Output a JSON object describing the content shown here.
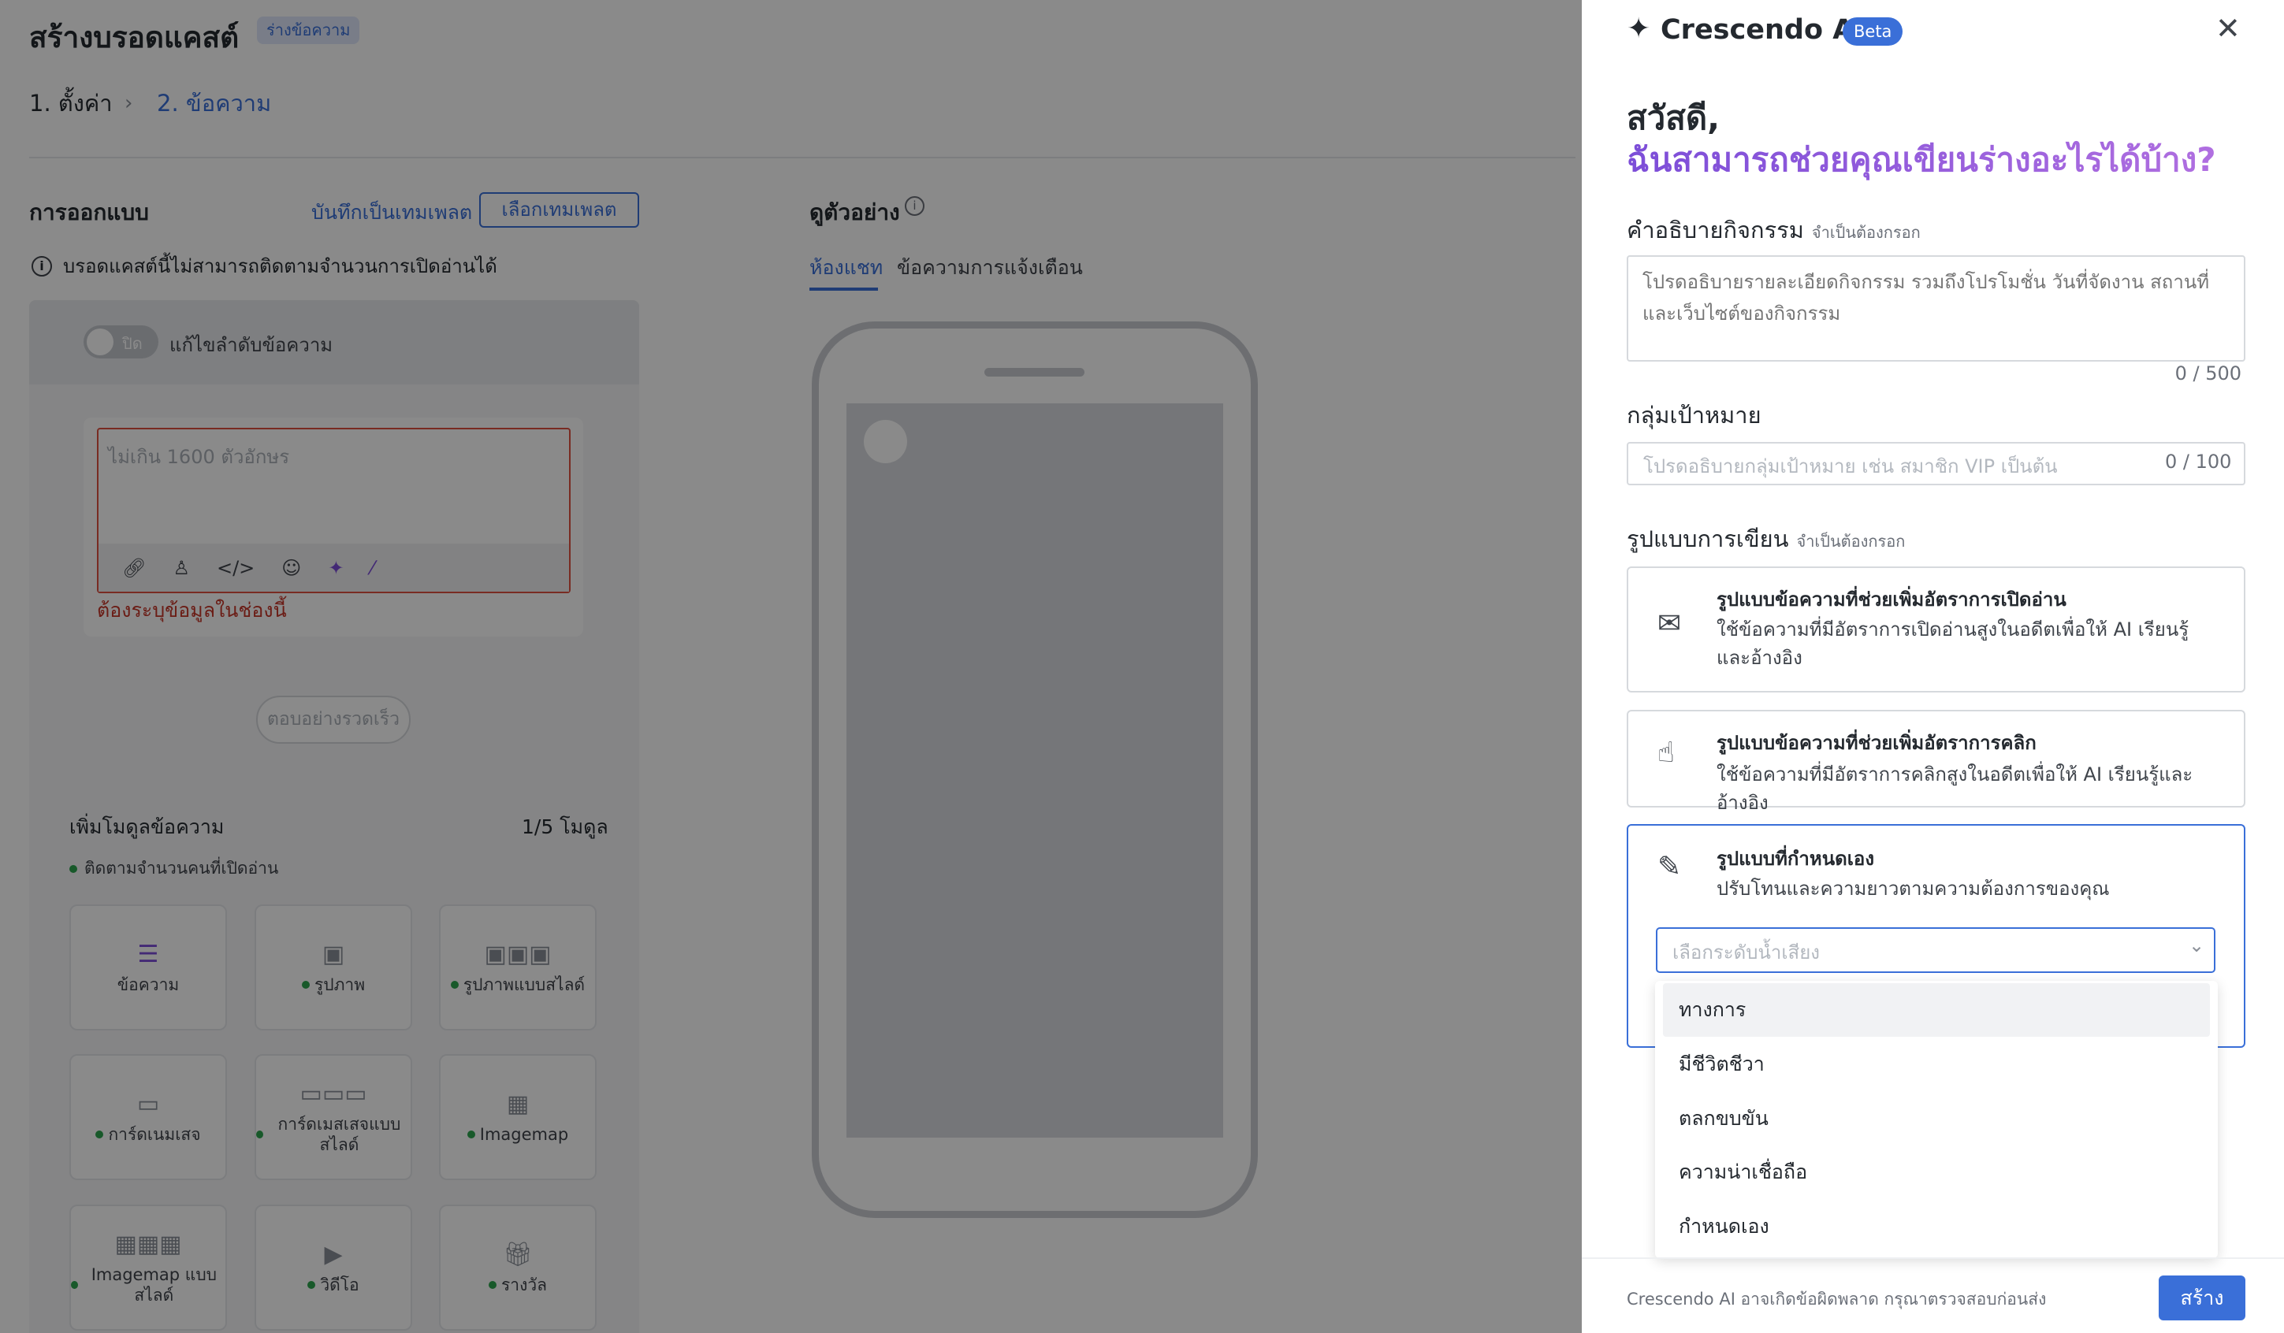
{
  "page": {
    "title": "สร้างบรอดแคสต์",
    "badge": "ร่างข้อความ",
    "steps": [
      "1. ตั้งค่า",
      "2. ข้อความ"
    ],
    "step_separator": "›"
  },
  "design": {
    "label": "การออกแบบ",
    "save_template": "บันทึกเป็นเทมเพลต",
    "choose_template": "เลือกเทมเพลต",
    "info": "บรอดแคสต์นี้ไม่สามารถติดตามจำนวนการเปิดอ่านได้",
    "toggle_state": "ปิด",
    "toggle_label": "แก้ไขลำดับข้อความ",
    "message_placeholder": "ไม่เกิน 1600 ตัวอักษร",
    "message_error": "ต้องระบุข้อมูลในช่องนี้",
    "quick_reply": "ตอบอย่างรวดเร็ว",
    "add_module": "เพิ่มโมดูลข้อความ",
    "module_count": "1/5 โมดูล",
    "track_readers": "ติดตามจำนวนคนที่เปิดอ่าน",
    "modules": [
      {
        "label": "ข้อความ",
        "icon": "text-icon",
        "dot": false
      },
      {
        "label": "รูปภาพ",
        "icon": "image-icon",
        "dot": true
      },
      {
        "label": "รูปภาพแบบสไลด์",
        "icon": "image-carousel-icon",
        "dot": true
      },
      {
        "label": "การ์ดเนมเสจ",
        "icon": "card-icon",
        "dot": true
      },
      {
        "label": "การ์ดเมสเสจแบบสไลด์",
        "icon": "card-carousel-icon",
        "dot": true
      },
      {
        "label": "Imagemap",
        "icon": "imagemap-icon",
        "dot": true
      },
      {
        "label": "Imagemap แบบสไลด์",
        "icon": "imagemap-carousel-icon",
        "dot": true
      },
      {
        "label": "วิดีโอ",
        "icon": "video-icon",
        "dot": true
      },
      {
        "label": "รางวัล",
        "icon": "gift-icon",
        "dot": true
      }
    ]
  },
  "preview": {
    "label": "ดูตัวอย่าง",
    "tabs": [
      "ห้องแชท",
      "ข้อความการแจ้งเตือน"
    ]
  },
  "ai": {
    "title": "Crescendo AI",
    "beta": "Beta",
    "greeting_line1": "สวัสดี,",
    "greeting_line2": "ฉันสามารถช่วยคุณเขียนร่างอะไรได้บ้าง?",
    "required": "จำเป็นต้องกรอก",
    "desc_label": "คำอธิบายกิจกรรม",
    "desc_placeholder": "โปรดอธิบายรายละเอียดกิจกรรม รวมถึงโปรโมชั่น วันที่จัดงาน สถานที่ และเว็บไซต์ของกิจกรรม",
    "desc_count": "0 / 500",
    "audience_label": "กลุ่มเป้าหมาย",
    "audience_placeholder": "โปรดอธิบายกลุ่มเป้าหมาย เช่น สมาชิก VIP เป็นต้น",
    "audience_count": "0 / 100",
    "style_label": "รูปแบบการเขียน",
    "options": [
      {
        "title": "รูปแบบข้อความที่ช่วยเพิ่มอัตราการเปิดอ่าน",
        "desc": "ใช้ข้อความที่มีอัตราการเปิดอ่านสูงในอดีตเพื่อให้ AI เรียนรู้และอ้างอิง",
        "icon": "inbox-icon"
      },
      {
        "title": "รูปแบบข้อความที่ช่วยเพิ่มอัตราการคลิก",
        "desc": "ใช้ข้อความที่มีอัตราการคลิกสูงในอดีตเพื่อให้ AI เรียนรู้และอ้างอิง",
        "icon": "tap-hand-icon"
      },
      {
        "title": "รูปแบบที่กำหนดเอง",
        "desc": "ปรับโทนและความยาวตามความต้องการของคุณ",
        "icon": "pencil-icon"
      }
    ],
    "tone_placeholder": "เลือกระดับน้ำเสียง",
    "tone_options": [
      "ทางการ",
      "มีชีวิตชีวา",
      "ตลกขบขัน",
      "ความน่าเชื่อถือ",
      "กำหนดเอง"
    ],
    "footer_note": "Crescendo AI อาจเกิดข้อผิดพลาด กรุณาตรวจสอบก่อนส่ง",
    "create_button": "สร้าง"
  },
  "colors": {
    "accent": "#3a6fd8",
    "ai_purple": "#7c4dd8",
    "error": "#c6372a",
    "status_dot": "#2da44e"
  }
}
